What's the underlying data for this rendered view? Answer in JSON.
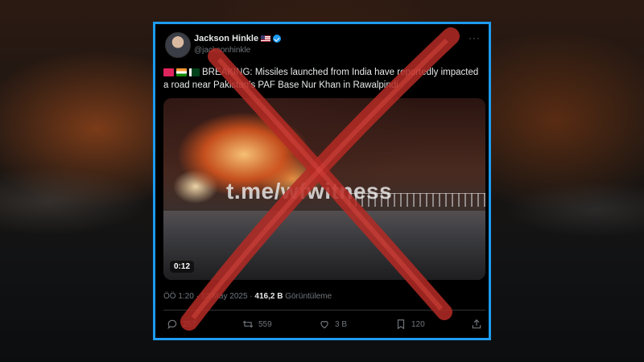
{
  "tweet": {
    "author_name": "Jackson Hinkle",
    "handle": "@jacksonhinkle",
    "more": "···",
    "text": "BREAKING: Missiles launched from India have reportedly impacted a road near Pakistan’s PAF Base Nur Khan in Rawalpindi",
    "media": {
      "watermark": "t.me/wfwitness",
      "duration": "0:12"
    },
    "time": "ÖÖ 1:20 · 10 May 2025 ·",
    "views_count": "416,2 B",
    "views_label": "Görüntüleme",
    "actions": {
      "replies": "257",
      "reposts": "559",
      "likes": "3 B",
      "bookmarks": "120"
    }
  },
  "colors": {
    "accent_border": "#1d9bf0",
    "cross": "#c0302a",
    "verified": "#1d9bf0"
  },
  "icons": [
    "verified-badge-icon",
    "us-flag-icon",
    "more-icon",
    "reply-icon",
    "repost-icon",
    "like-icon",
    "bookmark-icon",
    "share-icon",
    "siren-emoji-icon",
    "india-flag-emoji-icon",
    "pakistan-flag-emoji-icon"
  ]
}
